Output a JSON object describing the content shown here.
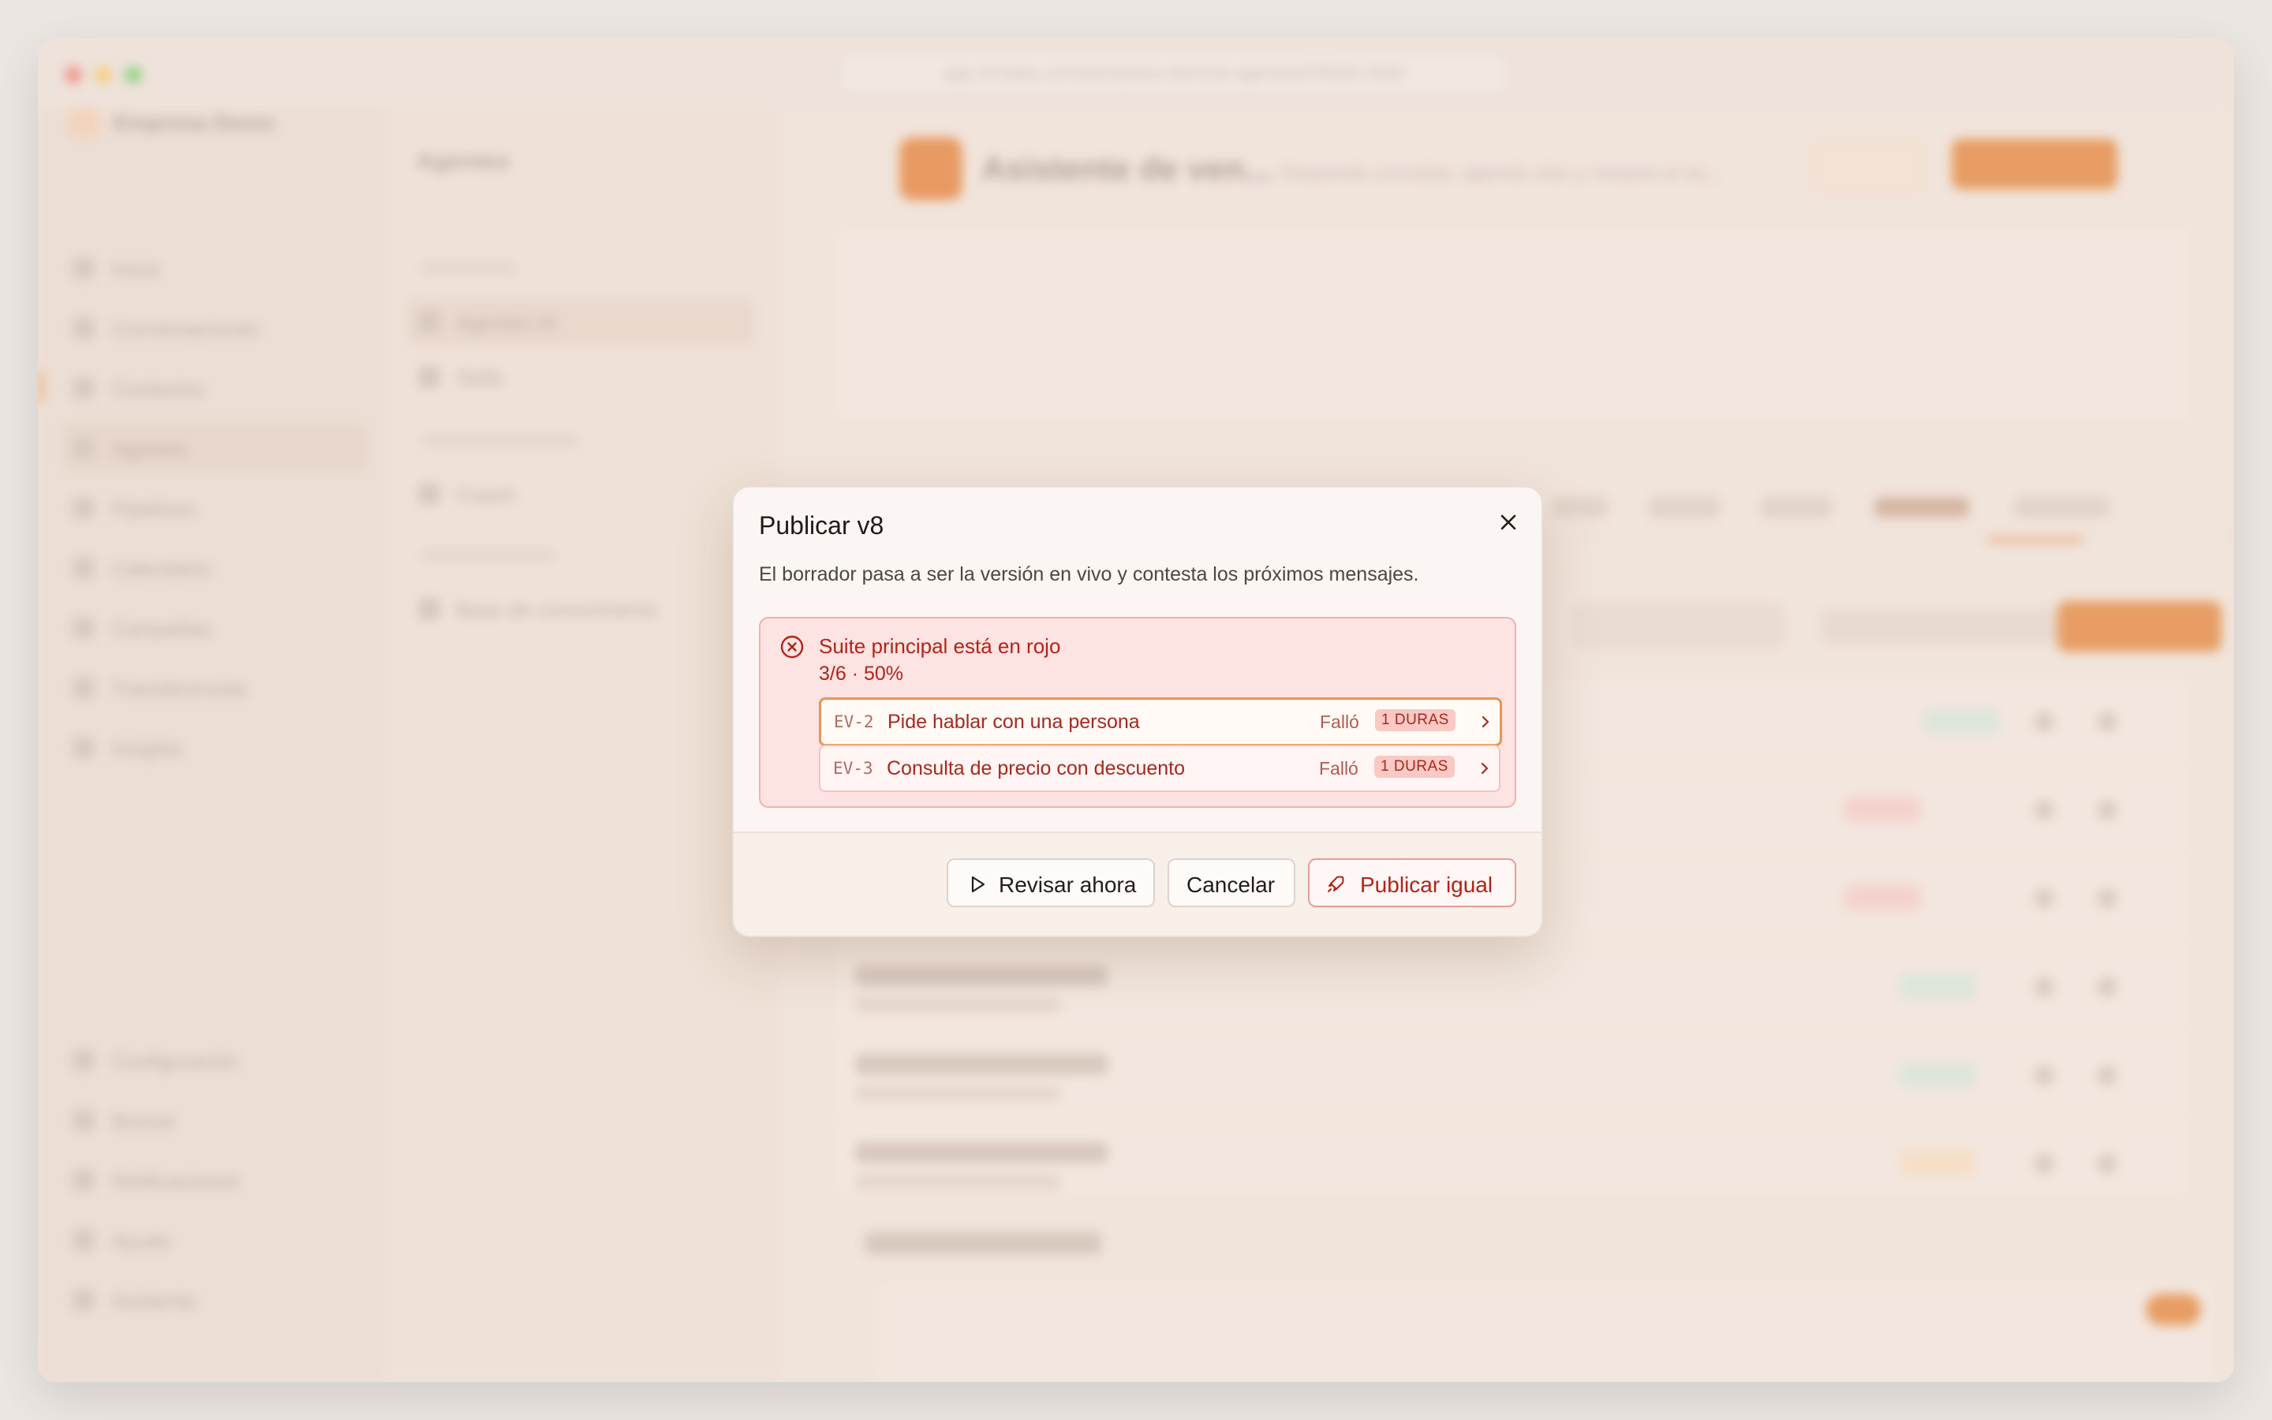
{
  "browser": {
    "url": "app.rinnaiba.com/e/empresa-demo/ai-agents/af7f0000-0000"
  },
  "background": {
    "workspace_name": "Empresa Demo",
    "nav": [
      "Inicio",
      "Conversaciones",
      "Contactos",
      "Agentes",
      "Pipelines",
      "Calendario",
      "Campañas",
      "Transferencias",
      "Insights"
    ],
    "nav_bottom": [
      "Configuración",
      "Buscar",
      "Notificaciones",
      "Ayuda",
      "Asistente"
    ],
    "sub_title": "Agentes",
    "sub_items": [
      "Agentes IA",
      "Skills",
      "Coach",
      "Base de conocimiento"
    ],
    "agent_name": "Asistente de ven...",
    "agent_desc": "Responde consultas, agenda citas y mequea el eq..."
  },
  "modal": {
    "title": "Publicar v8",
    "description": "El borrador pasa a ser la versión en vivo y contesta los próximos mensajes.",
    "alert": {
      "title": "Suite principal está en rojo",
      "subtitle": "3/6 · 50%",
      "failures": [
        {
          "id": "EV-2",
          "name": "Pide hablar con una persona",
          "status": "Falló",
          "badge": "1 DURAS"
        },
        {
          "id": "EV-3",
          "name": "Consulta de precio con descuento",
          "status": "Falló",
          "badge": "1 DURAS"
        }
      ]
    },
    "buttons": {
      "review": "Revisar ahora",
      "cancel": "Cancelar",
      "publish": "Publicar igual"
    }
  },
  "colors": {
    "accent": "#e0701f",
    "danger": "#b42318",
    "danger_bg": "#fde3e1"
  }
}
